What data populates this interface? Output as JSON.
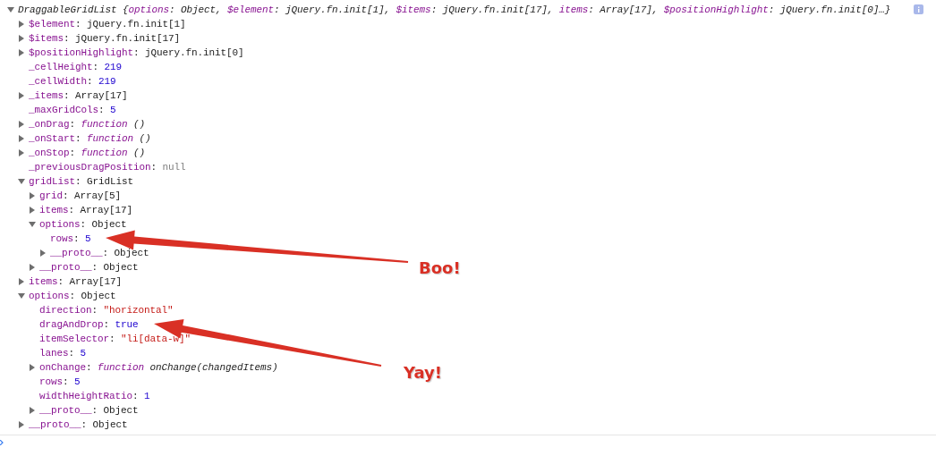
{
  "console": {
    "tree": [
      {
        "expanded": true,
        "segments": [
          {
            "text": "DraggableGridList {",
            "kind": "italic"
          },
          {
            "text": "options",
            "kind": "italic-key"
          },
          {
            "text": ": Object, ",
            "kind": "italic"
          },
          {
            "text": "$element",
            "kind": "italic-key"
          },
          {
            "text": ": jQuery.fn.init[1], ",
            "kind": "italic"
          },
          {
            "text": "$items",
            "kind": "italic-key"
          },
          {
            "text": ": jQuery.fn.init[17], ",
            "kind": "italic"
          },
          {
            "text": "items",
            "kind": "italic-key"
          },
          {
            "text": ": Array[17], ",
            "kind": "italic"
          },
          {
            "text": "$positionHighlight",
            "kind": "italic-key"
          },
          {
            "text": ": jQuery.fn.init[0]…}",
            "kind": "italic"
          }
        ],
        "children": [
          {
            "expanded": false,
            "segments": [
              {
                "text": "$element",
                "kind": "key"
              },
              {
                "text": ": jQuery.fn.init[1]",
                "kind": "plain"
              }
            ]
          },
          {
            "expanded": false,
            "segments": [
              {
                "text": "$items",
                "kind": "key"
              },
              {
                "text": ": jQuery.fn.init[17]",
                "kind": "plain"
              }
            ]
          },
          {
            "expanded": false,
            "segments": [
              {
                "text": "$positionHighlight",
                "kind": "key"
              },
              {
                "text": ": jQuery.fn.init[0]",
                "kind": "plain"
              }
            ]
          },
          {
            "segments": [
              {
                "text": "_cellHeight",
                "kind": "key"
              },
              {
                "text": ": ",
                "kind": "plain"
              },
              {
                "text": "219",
                "kind": "number"
              }
            ]
          },
          {
            "segments": [
              {
                "text": "_cellWidth",
                "kind": "key"
              },
              {
                "text": ": ",
                "kind": "plain"
              },
              {
                "text": "219",
                "kind": "number"
              }
            ]
          },
          {
            "expanded": false,
            "segments": [
              {
                "text": "_items",
                "kind": "key"
              },
              {
                "text": ": Array[17]",
                "kind": "plain"
              }
            ]
          },
          {
            "segments": [
              {
                "text": "_maxGridCols",
                "kind": "key"
              },
              {
                "text": ": ",
                "kind": "plain"
              },
              {
                "text": "5",
                "kind": "number"
              }
            ]
          },
          {
            "expanded": false,
            "segments": [
              {
                "text": "_onDrag",
                "kind": "key"
              },
              {
                "text": ": ",
                "kind": "plain"
              },
              {
                "text": "function",
                "kind": "function"
              },
              {
                "text": " ()",
                "kind": "italic"
              }
            ]
          },
          {
            "expanded": false,
            "segments": [
              {
                "text": "_onStart",
                "kind": "key"
              },
              {
                "text": ": ",
                "kind": "plain"
              },
              {
                "text": "function",
                "kind": "function"
              },
              {
                "text": " ()",
                "kind": "italic"
              }
            ]
          },
          {
            "expanded": false,
            "segments": [
              {
                "text": "_onStop",
                "kind": "key"
              },
              {
                "text": ": ",
                "kind": "plain"
              },
              {
                "text": "function",
                "kind": "function"
              },
              {
                "text": " ()",
                "kind": "italic"
              }
            ]
          },
          {
            "segments": [
              {
                "text": "_previousDragPosition",
                "kind": "key"
              },
              {
                "text": ": ",
                "kind": "plain"
              },
              {
                "text": "null",
                "kind": "null"
              }
            ]
          },
          {
            "expanded": true,
            "segments": [
              {
                "text": "gridList",
                "kind": "key"
              },
              {
                "text": ": GridList",
                "kind": "plain"
              }
            ],
            "children": [
              {
                "expanded": false,
                "segments": [
                  {
                    "text": "grid",
                    "kind": "key"
                  },
                  {
                    "text": ": Array[5]",
                    "kind": "plain"
                  }
                ]
              },
              {
                "expanded": false,
                "segments": [
                  {
                    "text": "items",
                    "kind": "key"
                  },
                  {
                    "text": ": Array[17]",
                    "kind": "plain"
                  }
                ]
              },
              {
                "expanded": true,
                "segments": [
                  {
                    "text": "options",
                    "kind": "key"
                  },
                  {
                    "text": ": Object",
                    "kind": "plain"
                  }
                ],
                "children": [
                  {
                    "segments": [
                      {
                        "text": "rows",
                        "kind": "key"
                      },
                      {
                        "text": ": ",
                        "kind": "plain"
                      },
                      {
                        "text": "5",
                        "kind": "number"
                      }
                    ]
                  },
                  {
                    "expanded": false,
                    "segments": [
                      {
                        "text": "__proto__",
                        "kind": "key"
                      },
                      {
                        "text": ": Object",
                        "kind": "plain"
                      }
                    ]
                  }
                ]
              },
              {
                "expanded": false,
                "segments": [
                  {
                    "text": "__proto__",
                    "kind": "key"
                  },
                  {
                    "text": ": Object",
                    "kind": "plain"
                  }
                ]
              }
            ]
          },
          {
            "expanded": false,
            "segments": [
              {
                "text": "items",
                "kind": "key"
              },
              {
                "text": ": Array[17]",
                "kind": "plain"
              }
            ]
          },
          {
            "expanded": true,
            "segments": [
              {
                "text": "options",
                "kind": "key"
              },
              {
                "text": ": Object",
                "kind": "plain"
              }
            ],
            "children": [
              {
                "segments": [
                  {
                    "text": "direction",
                    "kind": "key"
                  },
                  {
                    "text": ": ",
                    "kind": "plain"
                  },
                  {
                    "text": "\"horizontal\"",
                    "kind": "string"
                  }
                ]
              },
              {
                "segments": [
                  {
                    "text": "dragAndDrop",
                    "kind": "key"
                  },
                  {
                    "text": ": ",
                    "kind": "plain"
                  },
                  {
                    "text": "true",
                    "kind": "number"
                  }
                ]
              },
              {
                "segments": [
                  {
                    "text": "itemSelector",
                    "kind": "key"
                  },
                  {
                    "text": ": ",
                    "kind": "plain"
                  },
                  {
                    "text": "\"li[data-w]\"",
                    "kind": "string"
                  }
                ]
              },
              {
                "segments": [
                  {
                    "text": "lanes",
                    "kind": "key"
                  },
                  {
                    "text": ": ",
                    "kind": "plain"
                  },
                  {
                    "text": "5",
                    "kind": "number"
                  }
                ]
              },
              {
                "expanded": false,
                "segments": [
                  {
                    "text": "onChange",
                    "kind": "key"
                  },
                  {
                    "text": ": ",
                    "kind": "plain"
                  },
                  {
                    "text": "function",
                    "kind": "function"
                  },
                  {
                    "text": " onChange(changedItems)",
                    "kind": "italic"
                  }
                ]
              },
              {
                "segments": [
                  {
                    "text": "rows",
                    "kind": "key"
                  },
                  {
                    "text": ": ",
                    "kind": "plain"
                  },
                  {
                    "text": "5",
                    "kind": "number"
                  }
                ]
              },
              {
                "segments": [
                  {
                    "text": "widthHeightRatio",
                    "kind": "key"
                  },
                  {
                    "text": ": ",
                    "kind": "plain"
                  },
                  {
                    "text": "1",
                    "kind": "number"
                  }
                ]
              },
              {
                "expanded": false,
                "segments": [
                  {
                    "text": "__proto__",
                    "kind": "key"
                  },
                  {
                    "text": ": Object",
                    "kind": "plain"
                  }
                ]
              }
            ]
          },
          {
            "expanded": false,
            "segments": [
              {
                "text": "__proto__",
                "kind": "key"
              },
              {
                "text": ": Object",
                "kind": "plain"
              }
            ]
          }
        ]
      }
    ]
  },
  "annotations": [
    {
      "label": "Boo!"
    },
    {
      "label": "Yay!"
    }
  ]
}
